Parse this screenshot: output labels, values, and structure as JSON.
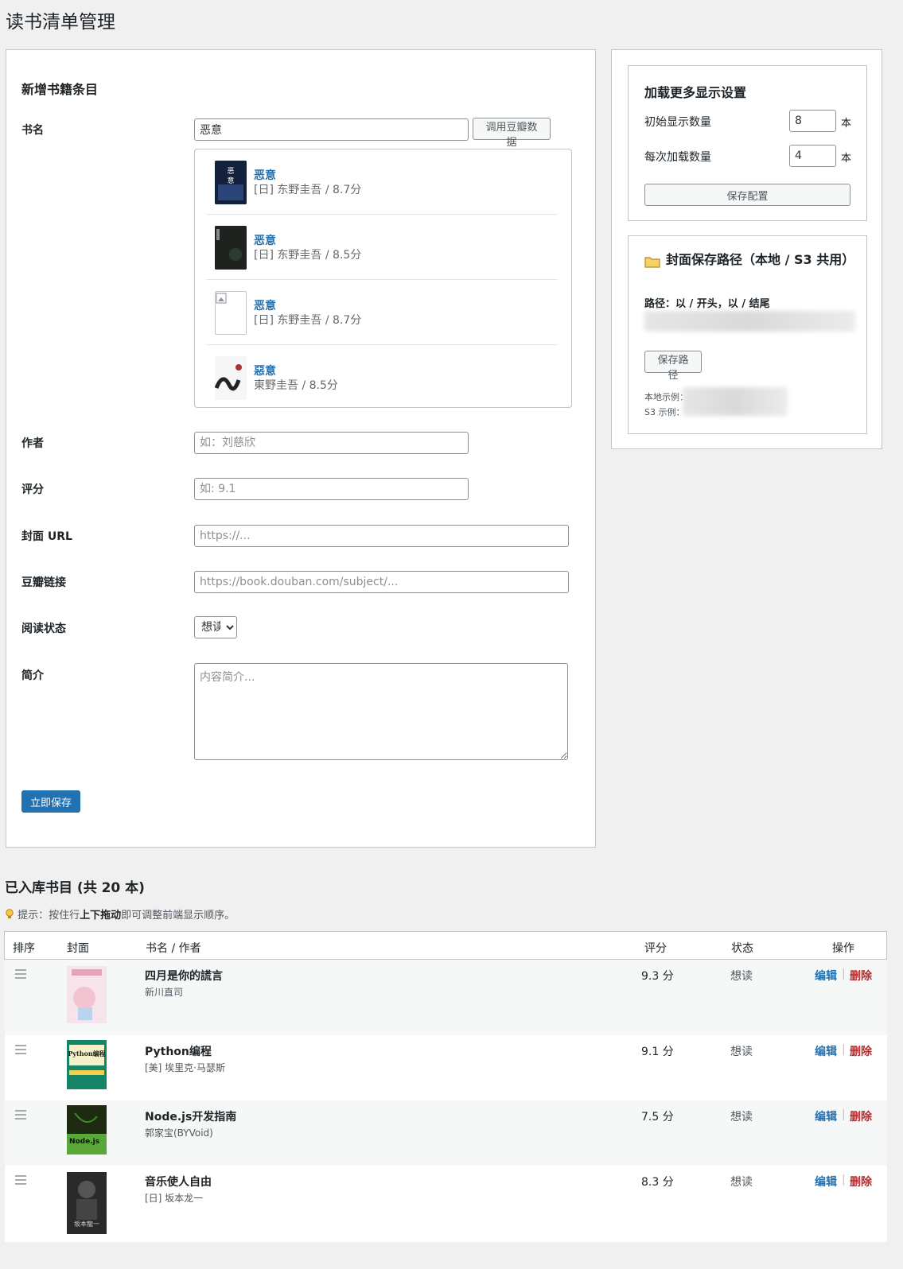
{
  "page": {
    "title": "读书清单管理"
  },
  "form": {
    "heading": "新增书籍条目",
    "title_label": "书名",
    "title_value": "恶意",
    "fetch_button": "调用豆瓣数据",
    "suggestions": [
      {
        "title": "恶意",
        "meta": "[日] 东野圭吾 / 8.7分",
        "cover_color": "#1b2a4a"
      },
      {
        "title": "恶意",
        "meta": "[日] 东野圭吾 / 8.5分",
        "cover_color": "#222222"
      },
      {
        "title": "恶意",
        "meta": "[日] 东野圭吾 / 8.7分",
        "cover_color": "#ffffff"
      },
      {
        "title": "惡意",
        "meta": "東野圭吾 / 8.5分",
        "cover_color": "#f3f3f3"
      }
    ],
    "author_label": "作者",
    "author_placeholder": "如：刘慈欣",
    "rating_label": "评分",
    "rating_placeholder": "如: 9.1",
    "cover_label": "封面 URL",
    "cover_placeholder": "https://...",
    "douban_label": "豆瓣链接",
    "douban_placeholder": "https://book.douban.com/subject/...",
    "status_label": "阅读状态",
    "status_value": "想读",
    "summary_label": "简介",
    "summary_placeholder": "内容简介...",
    "save_button": "立即保存"
  },
  "display_settings": {
    "heading": "加载更多显示设置",
    "initial_label": "初始显示数量",
    "initial_value": "8",
    "initial_unit": "本",
    "per_load_label": "每次加载数量",
    "per_load_value": "4",
    "per_load_unit": "本",
    "save_button": "保存配置"
  },
  "cover_path": {
    "heading": "封面保存路径（本地 / S3 共用）",
    "hint": "路径：以 / 开头，以 / 结尾",
    "save_button": "保存路径",
    "local_example_label": "本地示例：",
    "s3_example_label": "S3 示例："
  },
  "list": {
    "heading": "已入库书目 (共 20 本)",
    "tip_prefix": "提示：按住行",
    "tip_bold": "上下拖动",
    "tip_suffix": "即可调整前端显示顺序。",
    "columns": {
      "order": "排序",
      "cover": "封面",
      "title_author": "书名 / 作者",
      "rating": "评分",
      "status": "状态",
      "actions": "操作"
    },
    "edit_label": "编辑",
    "separator": "|",
    "delete_label": "删除",
    "rows": [
      {
        "title": "四月是你的謊言",
        "author": "新川直司",
        "rating": "9.3 分",
        "status": "想读",
        "cover_color": "#f4d6e0"
      },
      {
        "title": "Python编程",
        "author": "[美] 埃里克·马瑟斯",
        "rating": "9.1 分",
        "status": "想读",
        "cover_color": "#1a8a6a"
      },
      {
        "title": "Node.js开发指南",
        "author": "郭家宝(BYVoid)",
        "rating": "7.5 分",
        "status": "想读",
        "cover_color": "#3b7d23"
      },
      {
        "title": "音乐使人自由",
        "author": "[日] 坂本龙一",
        "rating": "8.3 分",
        "status": "想读",
        "cover_color": "#2b2b2b"
      }
    ]
  }
}
